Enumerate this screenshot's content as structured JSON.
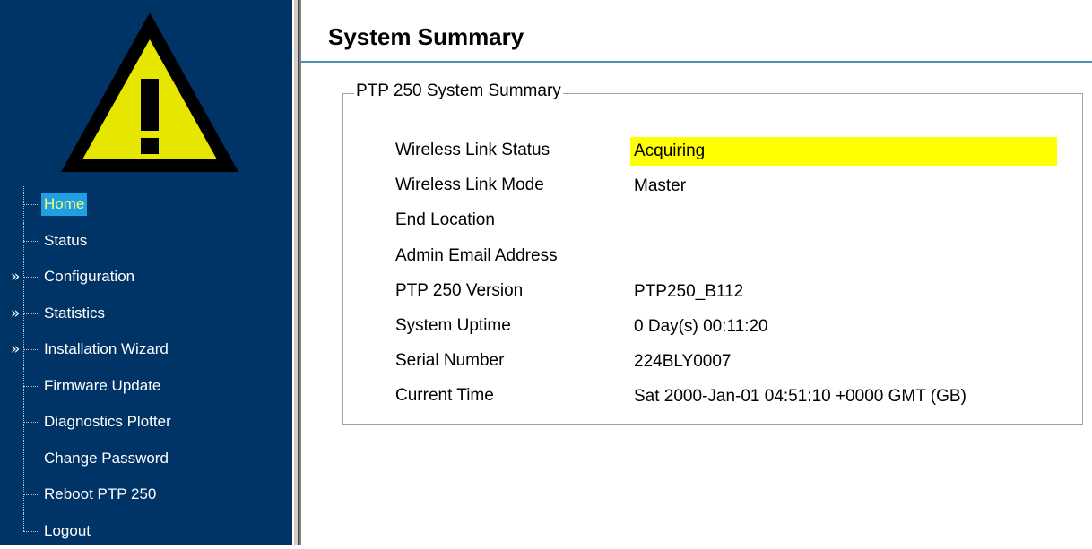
{
  "sidebar": {
    "logo_icon": "warning-triangle-icon",
    "colors": {
      "background": "#003366",
      "active_bg": "#1ea0e6",
      "active_text": "#ffff66",
      "warning_fill": "#e6e600"
    },
    "items": [
      {
        "label": "Home",
        "active": true,
        "expandable": false
      },
      {
        "label": "Status",
        "active": false,
        "expandable": false
      },
      {
        "label": "Configuration",
        "active": false,
        "expandable": true
      },
      {
        "label": "Statistics",
        "active": false,
        "expandable": true
      },
      {
        "label": "Installation Wizard",
        "active": false,
        "expandable": true
      },
      {
        "label": "Firmware Update",
        "active": false,
        "expandable": false
      },
      {
        "label": "Diagnostics Plotter",
        "active": false,
        "expandable": false
      },
      {
        "label": "Change Password",
        "active": false,
        "expandable": false
      },
      {
        "label": "Reboot PTP 250",
        "active": false,
        "expandable": false
      },
      {
        "label": "Logout",
        "active": false,
        "expandable": false
      }
    ],
    "expander_glyph": "»"
  },
  "main": {
    "title": "System Summary",
    "summary": {
      "legend": "PTP 250 System Summary",
      "rows": [
        {
          "label": "Wireless Link Status",
          "value": "Acquiring",
          "highlight": true
        },
        {
          "label": "Wireless Link Mode",
          "value": "Master",
          "highlight": false
        },
        {
          "label": "End Location",
          "value": "",
          "highlight": false
        },
        {
          "label": "Admin Email Address",
          "value": "",
          "highlight": false
        },
        {
          "label": "PTP 250 Version",
          "value": "PTP250_B112",
          "highlight": false
        },
        {
          "label": "System Uptime",
          "value": "0 Day(s) 00:11:20",
          "highlight": false
        },
        {
          "label": "Serial Number",
          "value": "224BLY0007",
          "highlight": false
        },
        {
          "label": "Current Time",
          "value": "Sat 2000-Jan-01 04:51:10 +0000 GMT (GB)",
          "highlight": false
        }
      ]
    },
    "colors": {
      "status_highlight": "#ffff00",
      "title_rule": "#4f8fc0"
    }
  }
}
